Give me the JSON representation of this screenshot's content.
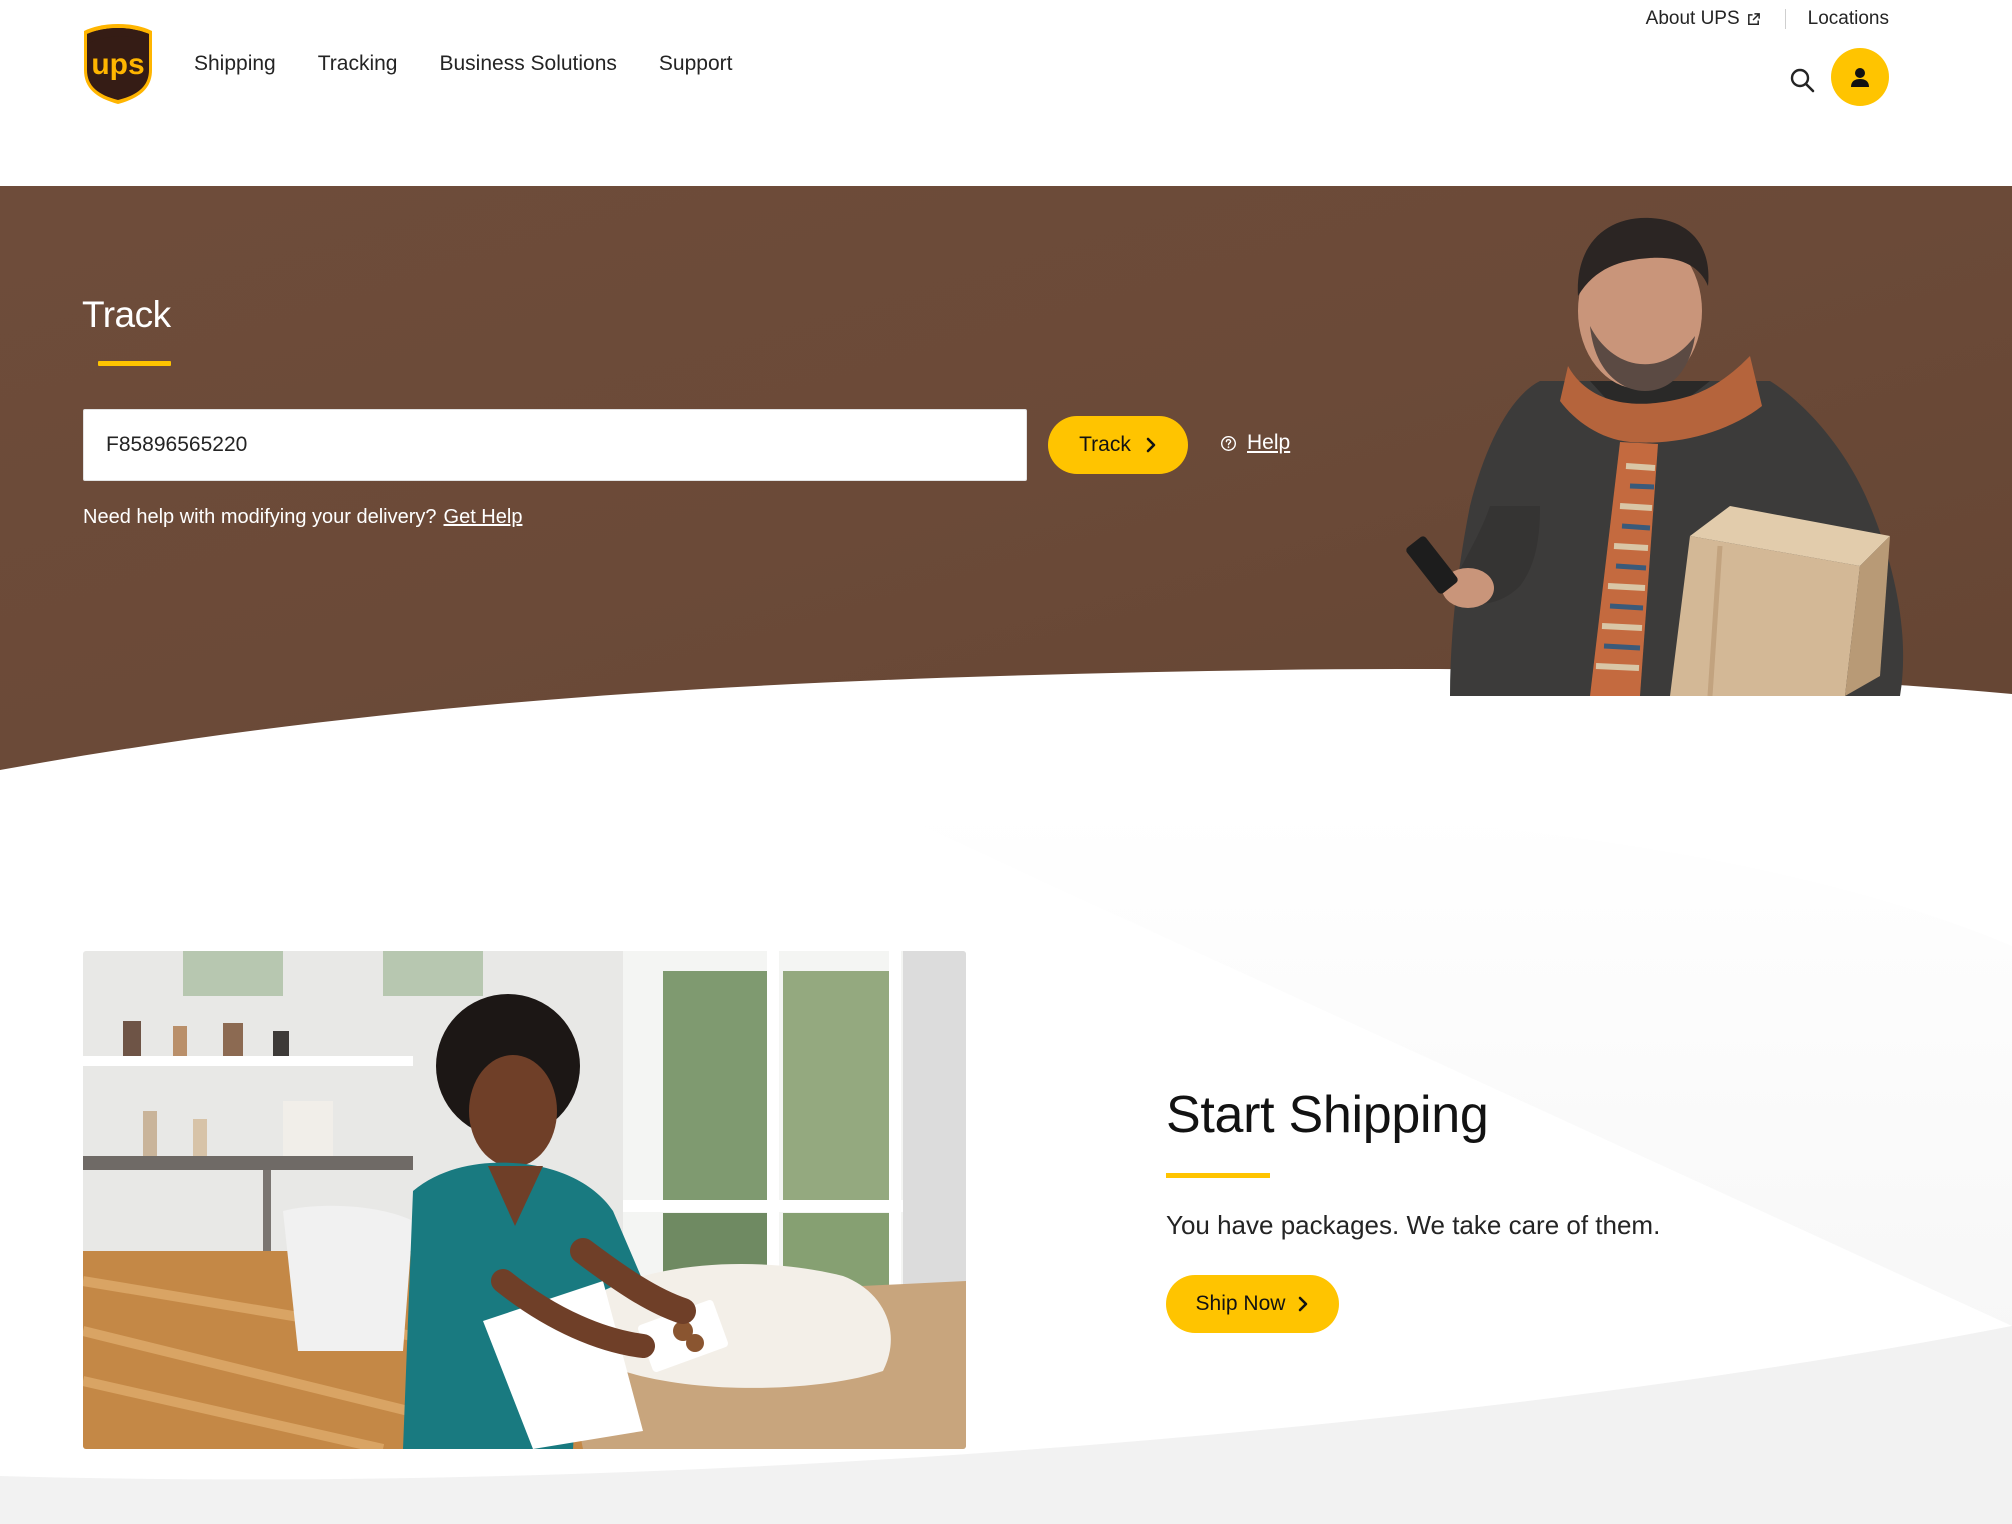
{
  "brand": {
    "logo_text": "ups",
    "accent": "#ffc400",
    "brown": "#6b4a38"
  },
  "nav": {
    "items": [
      {
        "label": "Shipping"
      },
      {
        "label": "Tracking"
      },
      {
        "label": "Business Solutions"
      },
      {
        "label": "Support"
      }
    ]
  },
  "util_nav": {
    "about_label": "About UPS",
    "about_icon": "external-link-icon",
    "locations_label": "Locations"
  },
  "header_icons": {
    "search": "search-icon",
    "account": "user-icon"
  },
  "hero": {
    "title": "Track",
    "tracking_value": "F85896565220",
    "track_button_label": "Track",
    "help_label": "Help",
    "delivery_question": "Need help with modifying your delivery?",
    "get_help_label": "Get Help"
  },
  "shipping": {
    "title": "Start Shipping",
    "subtitle": "You have packages. We take care of them.",
    "button_label": "Ship Now"
  }
}
